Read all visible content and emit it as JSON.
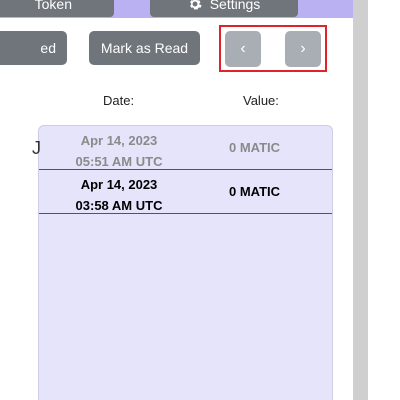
{
  "toolbar": {
    "token_label": "Token",
    "settings_label": "Settings"
  },
  "actions": {
    "mark_read_partial_label": "ed",
    "mark_as_read_label": "Mark as Read"
  },
  "pager": {
    "prev_label": "‹",
    "next_label": "›"
  },
  "columns": {
    "date": "Date:",
    "value": "Value:"
  },
  "rows": [
    {
      "date": "Apr 14, 2023",
      "time": "05:51 AM UTC",
      "value": "0 MATIC",
      "read": true
    },
    {
      "date": "Apr 14, 2023",
      "time": "03:58 AM UTC",
      "value": "0 MATIC",
      "read": false
    }
  ],
  "edge_glyph": "J",
  "colors": {
    "banner": "#b9b1f2",
    "panel": "#e6e4fb",
    "button": "#6f757b",
    "pager_button": "#a8aeb4",
    "highlight": "#e0222b"
  }
}
